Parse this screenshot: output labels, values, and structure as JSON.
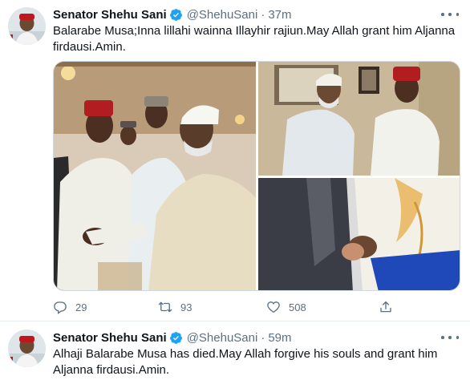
{
  "tweets": [
    {
      "author_name": "Senator Shehu Sani",
      "handle": "@ShehuSani",
      "separator": "·",
      "time": "37m",
      "text_line1": "Balarabe Musa;Inna lillahi wainna Illayhir rajiun.May Allah grant him Aljanna",
      "text_line2": "firdausi.Amin.",
      "replies": "29",
      "retweets": "93",
      "likes": "508",
      "avatar_icon": "profile-photo",
      "verified_icon": "verified-badge-icon"
    },
    {
      "author_name": "Senator Shehu Sani",
      "handle": "@ShehuSani",
      "separator": "·",
      "time": "59m",
      "text_line1": "Alhaji Balarabe Musa has died.May Allah forgive his souls and grant him",
      "text_line2": "Aljanna firdausi.Amin.",
      "avatar_icon": "profile-photo",
      "verified_icon": "verified-badge-icon"
    }
  ],
  "colors": {
    "text_primary": "#0f1419",
    "text_secondary": "#5b7083",
    "verified_blue": "#1da1f2",
    "divider": "#e6ecf0"
  }
}
